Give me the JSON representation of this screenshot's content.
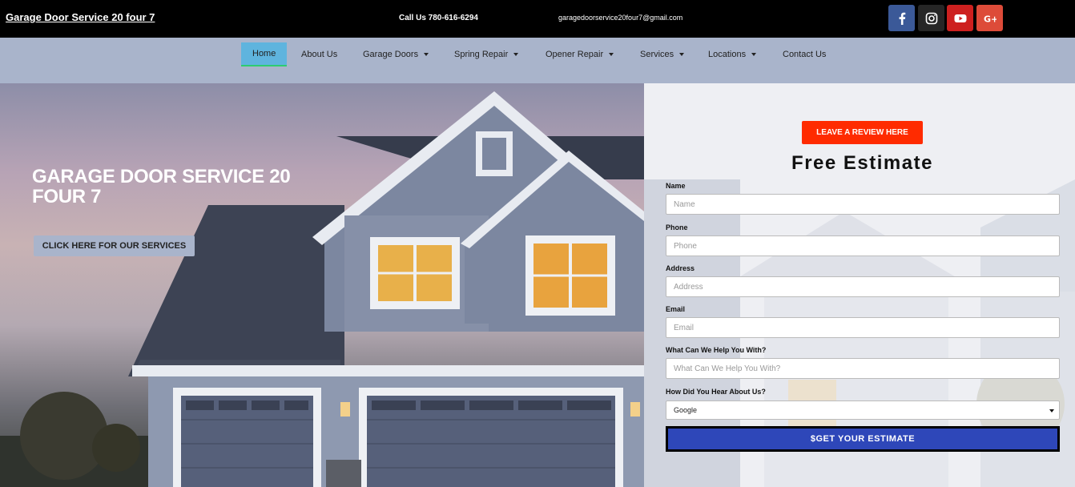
{
  "topbar": {
    "brand": "Garage Door Service 20 four 7",
    "phone": "Call Us 780-616-6294",
    "email": "garagedoorservice20four7@gmail.com",
    "social": [
      {
        "icon": "facebook-icon",
        "color": "#3b5998"
      },
      {
        "icon": "instagram-icon",
        "color": "#262626"
      },
      {
        "icon": "youtube-icon",
        "color": "#cd201f"
      },
      {
        "icon": "google-plus-icon",
        "color": "#dd4b39"
      }
    ]
  },
  "nav": {
    "items": [
      {
        "label": "Home",
        "active": true
      },
      {
        "label": "About Us"
      },
      {
        "label": "Garage Doors",
        "dropdown": true
      },
      {
        "label": "Spring Repair",
        "dropdown": true
      },
      {
        "label": "Opener Repair",
        "dropdown": true
      },
      {
        "label": "Services",
        "dropdown": true
      },
      {
        "label": "Locations",
        "dropdown": true
      },
      {
        "label": "Contact Us"
      }
    ]
  },
  "hero": {
    "title": "GARAGE DOOR SERVICE 20 FOUR 7",
    "button": "CLICK HERE FOR OUR SERVICES"
  },
  "form": {
    "review_button": "LEAVE A REVIEW HERE",
    "title": "Free Estimate",
    "fields": [
      {
        "label": "Name",
        "placeholder": "Name"
      },
      {
        "label": "Phone",
        "placeholder": "Phone"
      },
      {
        "label": "Address",
        "placeholder": "Address"
      },
      {
        "label": "Email",
        "placeholder": "Email"
      },
      {
        "label": "What Can We Help You With?",
        "placeholder": "What Can We Help You With?"
      }
    ],
    "select_label": "How Did You Hear About Us?",
    "select_value": "Google",
    "submit": "$GET YOUR ESTIMATE"
  },
  "colors": {
    "topbar": "#000000",
    "nav": "#a9b4cb",
    "nav_active": "#5fb4de",
    "review": "#ff2b00",
    "submit": "#2e47b9"
  }
}
